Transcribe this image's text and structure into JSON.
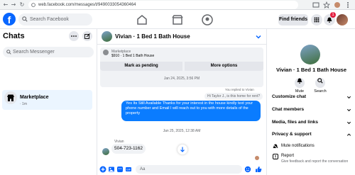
{
  "browser": {
    "url": "web.facebook.com/messages/t/9490033054360464"
  },
  "facebook": {
    "logo": "f",
    "search_placeholder": "Search Facebook",
    "find_friends": "Find friends",
    "notification_count": "1"
  },
  "sidebar": {
    "title": "Chats",
    "search_placeholder": "Search Messenger",
    "conversations": [
      {
        "name": "Marketplace",
        "subtitle": "· 1m"
      }
    ]
  },
  "chat": {
    "name": "Vivian · 1 Bed 1 Bath House",
    "marketplace_label": "Marketplace",
    "listing": "$910 · 1 Bed 1 Bath House",
    "mark_pending": "Mark as pending",
    "more_options": "More options",
    "timestamp1": "Jan 24, 2025, 3:56 PM",
    "reply_note": "You replied to Vivian",
    "quoted": "Hi Taylor J., is this home for rent?",
    "message_sent": "Yes Its Still Available Thanks for your interest in the house kindly text your phone number and Email I will reach out to you with more details of the property",
    "timestamp2": "Jan 25, 2025, 12:38 AM",
    "sender_name": "Vivian",
    "message_received": "504-723-1162",
    "composer_placeholder": "Aa"
  },
  "right_panel": {
    "name": "Vivian · 1 Bed 1 Bath House",
    "mute_label": "Mute",
    "search_label": "Search",
    "customize_chat": "Customize chat",
    "chat_members": "Chat members",
    "media_files": "Media, files and links",
    "privacy_support": "Privacy & support",
    "mute_notifications": "Mute notifications",
    "report": "Report",
    "report_note": "Give feedback and report the conversation"
  },
  "colors": {
    "brand": "#0866ff",
    "sent_bubble": "#0a7cff",
    "selected_conv": "#ebf5ff"
  }
}
